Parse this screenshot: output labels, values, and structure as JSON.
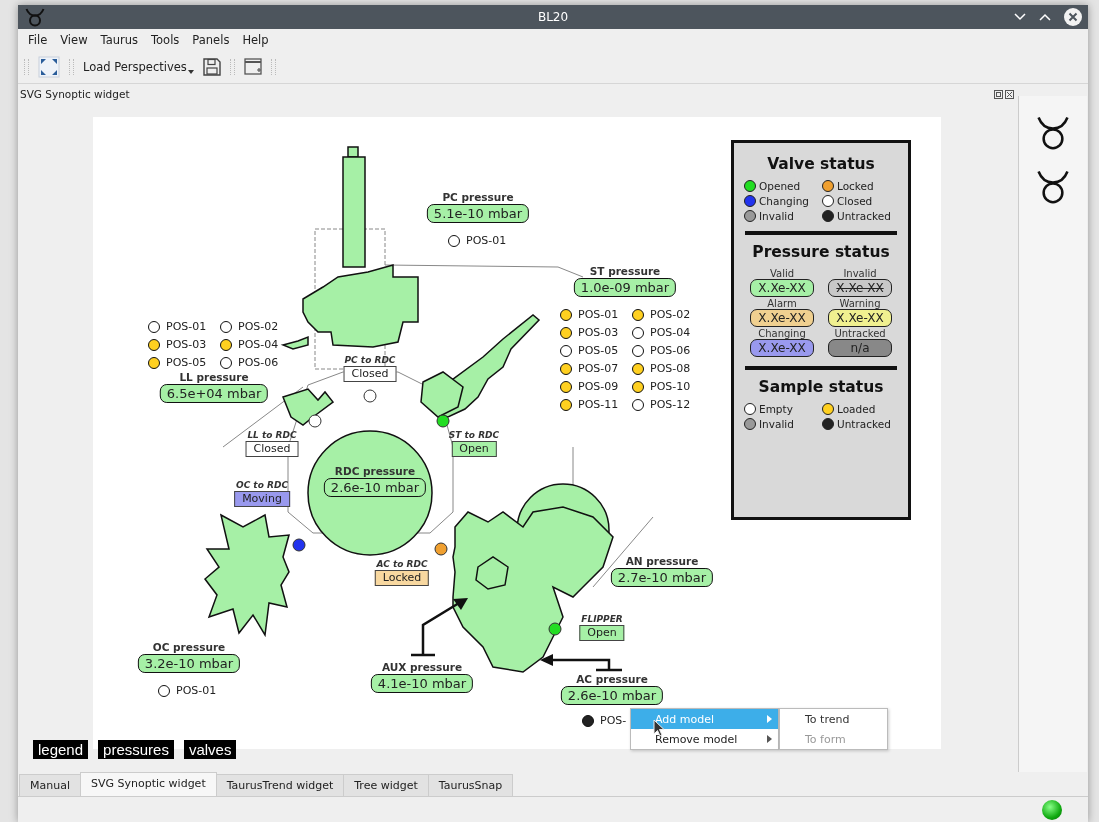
{
  "window": {
    "title": "BL20"
  },
  "menu": [
    "File",
    "View",
    "Taurus",
    "Tools",
    "Panels",
    "Help"
  ],
  "toolbar": {
    "perspectives": "Load Perspectives"
  },
  "dock_title": "SVG Synoptic widget",
  "synoptic": {
    "pressures": [
      {
        "name": "PC pressure",
        "value": "5.1e-10 mbar",
        "color": "#a6f0a6"
      },
      {
        "name": "ST pressure",
        "value": "1.0e-09 mbar",
        "color": "#a6f0a6"
      },
      {
        "name": "LL pressure",
        "value": "6.5e+04 mbar",
        "color": "#a6f0a6"
      },
      {
        "name": "RDC pressure",
        "value": "2.6e-10 mbar",
        "color": "#a6f0a6"
      },
      {
        "name": "AN pressure",
        "value": "2.7e-10 mbar",
        "color": "#a6f0a6"
      },
      {
        "name": "OC pressure",
        "value": "3.2e-10 mbar",
        "color": "#a6f0a6"
      },
      {
        "name": "AUX pressure",
        "value": "4.1e-10 mbar",
        "color": "#a6f0a6"
      },
      {
        "name": "AC pressure",
        "value": "2.6e-10 mbar",
        "color": "#a6f0a6"
      }
    ],
    "samples": [
      {
        "items": [
          {
            "label": "POS-01",
            "color": "#ffffff"
          }
        ]
      },
      {
        "items": [
          {
            "label": "POS-01",
            "color": "#ffffff"
          },
          {
            "label": "POS-02",
            "color": "#ffffff"
          },
          {
            "label": "POS-03",
            "color": "#ffd020"
          },
          {
            "label": "POS-04",
            "color": "#ffd020"
          },
          {
            "label": "POS-05",
            "color": "#ffd020"
          },
          {
            "label": "POS-06",
            "color": "#ffffff"
          }
        ]
      },
      {
        "items": [
          {
            "label": "POS-01",
            "color": "#ffd020"
          },
          {
            "label": "POS-02",
            "color": "#ffd020"
          },
          {
            "label": "POS-03",
            "color": "#ffd020"
          },
          {
            "label": "POS-04",
            "color": "#ffffff"
          },
          {
            "label": "POS-05",
            "color": "#ffffff"
          },
          {
            "label": "POS-06",
            "color": "#ffffff"
          },
          {
            "label": "POS-07",
            "color": "#ffd020"
          },
          {
            "label": "POS-08",
            "color": "#ffd020"
          },
          {
            "label": "POS-09",
            "color": "#ffd020"
          },
          {
            "label": "POS-10",
            "color": "#ffd020"
          },
          {
            "label": "POS-11",
            "color": "#ffd020"
          },
          {
            "label": "POS-12",
            "color": "#ffffff"
          }
        ]
      },
      {
        "items": [
          {
            "label": "POS-01",
            "color": "#ffffff"
          }
        ]
      },
      {
        "items": [
          {
            "label": "POS-",
            "color": "#222222"
          }
        ]
      }
    ],
    "valves": [
      {
        "name": "PC to RDC",
        "state": "Closed",
        "kind": "closed"
      },
      {
        "name": "LL to RDC",
        "state": "Closed",
        "kind": "closed"
      },
      {
        "name": "ST to RDC",
        "state": "Open",
        "kind": "opened"
      },
      {
        "name": "OC to RDC",
        "state": "Moving",
        "kind": "changing"
      },
      {
        "name": "AC to RDC",
        "state": "Locked",
        "kind": "locked"
      },
      {
        "name": "FLIPPER",
        "state": "Open",
        "kind": "opened"
      }
    ],
    "legend": {
      "valve_title": "Valve status",
      "valve_items": [
        {
          "label": "Opened",
          "color": "#22dd22"
        },
        {
          "label": "Locked",
          "color": "#f0a030"
        },
        {
          "label": "Changing",
          "color": "#2233ee"
        },
        {
          "label": "Closed",
          "color": "#ffffff"
        },
        {
          "label": "Invalid",
          "color": "#999999"
        },
        {
          "label": "Untracked",
          "color": "#222222"
        }
      ],
      "pressure_title": "Pressure status",
      "pressure_items": [
        {
          "label": "Valid",
          "value": "X.Xe-XX",
          "color": "#a6f0a6",
          "struck": false
        },
        {
          "label": "Invalid",
          "value": "X.Xe-XX",
          "color": "#c8c8c8",
          "struck": true
        },
        {
          "label": "Alarm",
          "value": "X.Xe-XX",
          "color": "#f0d090",
          "struck": false
        },
        {
          "label": "Warning",
          "value": "X.Xe-XX",
          "color": "#f0f090",
          "struck": false
        },
        {
          "label": "Changing",
          "value": "X.Xe-XX",
          "color": "#9999ee",
          "struck": false
        },
        {
          "label": "Untracked",
          "value": "n/a",
          "color": "#888888",
          "struck": false
        }
      ],
      "sample_title": "Sample status",
      "sample_items": [
        {
          "label": "Empty",
          "color": "#ffffff"
        },
        {
          "label": "Loaded",
          "color": "#ffd020"
        },
        {
          "label": "Invalid",
          "color": "#999999"
        },
        {
          "label": "Untracked",
          "color": "#222222"
        }
      ]
    }
  },
  "overlay_buttons": [
    "legend",
    "pressures",
    "valves"
  ],
  "context_menu": {
    "items": [
      {
        "label": "Add model",
        "selected": true
      },
      {
        "label": "Remove model",
        "selected": false
      }
    ],
    "submenu": [
      {
        "label": "To trend",
        "disabled": false
      },
      {
        "label": "To form",
        "disabled": true
      }
    ]
  },
  "tabs": [
    {
      "label": "Manual",
      "selected": false
    },
    {
      "label": "SVG Synoptic widget",
      "selected": true
    },
    {
      "label": "TaurusTrend widget",
      "selected": false
    },
    {
      "label": "Tree widget",
      "selected": false
    },
    {
      "label": "TaurusSnap",
      "selected": false
    }
  ]
}
